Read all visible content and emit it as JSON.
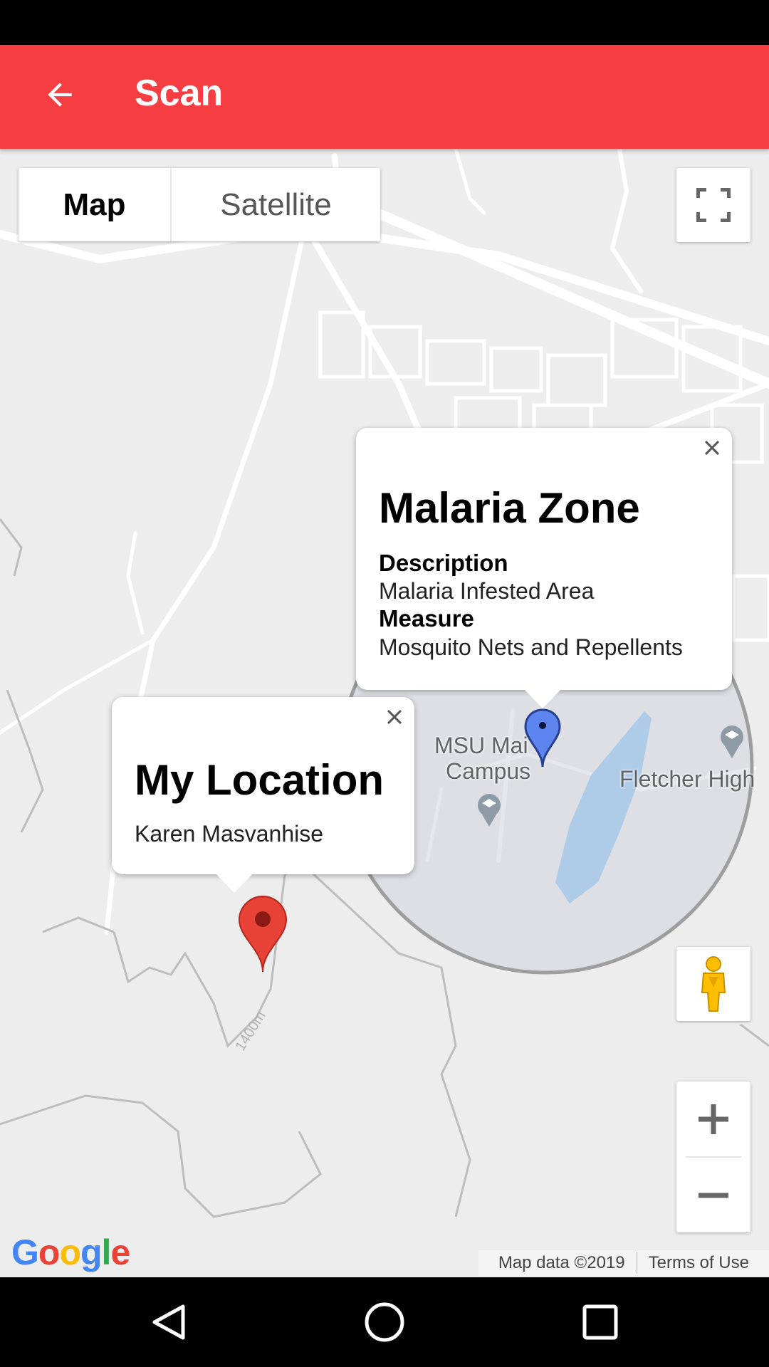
{
  "app_bar": {
    "title": "Scan",
    "back_icon": "arrow-back-icon"
  },
  "map": {
    "type_control": {
      "map_label": "Map",
      "satellite_label": "Satellite",
      "selected": "Map"
    },
    "place_labels": {
      "campus": "MSU Main Campus",
      "campus_line1": "MSU Mai",
      "campus_line2": "Campus",
      "school": "Fletcher High"
    },
    "contour_label": "1400m",
    "zone": {
      "fill": "#d0d4dc",
      "stroke": "#9e9e9e"
    },
    "markers": {
      "zone_marker_color": "#5c85f0",
      "location_marker_color": "#e74235"
    },
    "info_windows": {
      "malaria": {
        "title": "Malaria Zone",
        "description_label": "Description",
        "description": "Malaria Infested Area",
        "measure_label": "Measure",
        "measure": "Mosquito Nets and Repellents"
      },
      "my_location": {
        "title": "My Location",
        "name": "Karen Masvanhise"
      }
    },
    "controls": {
      "fullscreen_icon": "fullscreen-icon",
      "pegman_icon": "pegman-icon",
      "zoom_in": "+",
      "zoom_out": "−"
    },
    "logo": "Google",
    "attribution": {
      "map_data": "Map data ©2019",
      "terms": "Terms of Use"
    }
  },
  "nav_bar": {
    "back_icon": "triangle-back-icon",
    "home_icon": "circle-home-icon",
    "recents_icon": "square-recents-icon"
  },
  "colors": {
    "app_bar": "#f53d42",
    "map_bg": "#ededed"
  }
}
